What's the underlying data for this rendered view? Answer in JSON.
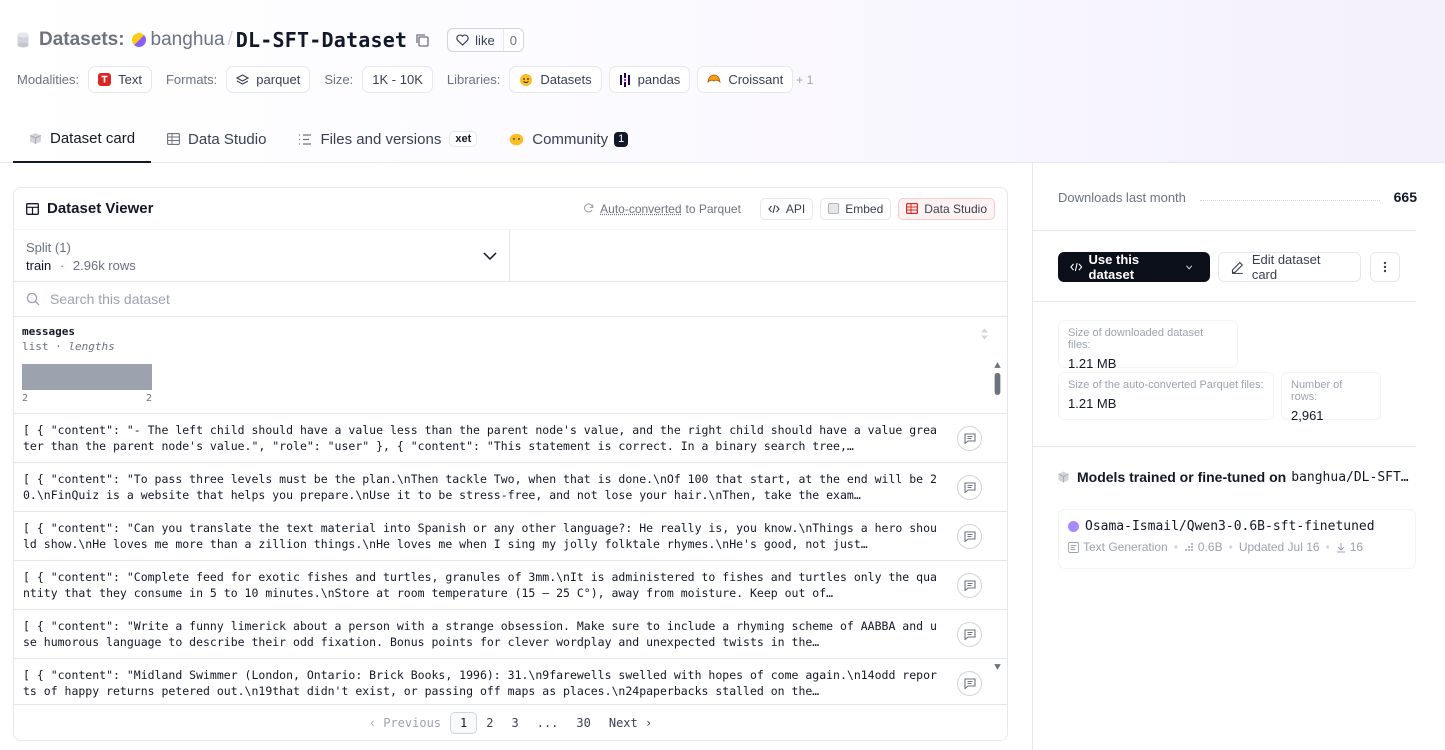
{
  "header": {
    "section": "Datasets:",
    "owner": "banghua",
    "slash": "/",
    "name": "DL-SFT-Dataset",
    "like_label": "like",
    "like_count": "0"
  },
  "meta": {
    "modalities_label": "Modalities:",
    "modality": "Text",
    "formats_label": "Formats:",
    "format": "parquet",
    "size_label": "Size:",
    "size": "1K - 10K",
    "libraries_label": "Libraries:",
    "libraries": [
      "Datasets",
      "pandas",
      "Croissant"
    ],
    "more_libraries": "+ 1"
  },
  "tabs": {
    "dataset_card": "Dataset card",
    "data_studio": "Data Studio",
    "files": "Files and versions",
    "xet": "xet",
    "community": "Community",
    "community_count": "1"
  },
  "viewer": {
    "title": "Dataset Viewer",
    "autoconverted": "Auto-converted",
    "autoconverted_suffix": "to Parquet",
    "api": "API",
    "embed": "Embed",
    "data_studio": "Data Studio",
    "split_label": "Split (1)",
    "split_name": "train",
    "split_sep": "·",
    "split_rows": "2.96k rows",
    "search_placeholder": "Search this dataset",
    "column": {
      "name": "messages",
      "type": "list",
      "type_sep": "·",
      "type_detail": "lengths",
      "hist_min": "2",
      "hist_max": "2"
    },
    "rows": [
      "[ { \"content\": \"- The left child should have a value less than the parent node's value, and the right child should have a value greater than the parent node's value.\", \"role\": \"user\" }, { \"content\": \"This statement is correct. In a binary search tree,…",
      "[ { \"content\": \"To pass three levels must be the plan.\\nThen tackle Two, when that is done.\\nOf 100 that start, at the end will be 20.\\nFinQuiz is a website that helps you prepare.\\nUse it to be stress-free, and not lose your hair.\\nThen, take the exam…",
      "[ { \"content\": \"Can you translate the text material into Spanish or any other language?: He really is, you know.\\nThings a hero should show.\\nHe loves me more than a zillion things.\\nHe loves me when I sing my jolly folktale rhymes.\\nHe's good, not just…",
      "[ { \"content\": \"Complete feed for exotic fishes and turtles, granules of 3mm.\\nIt is administered to fishes and turtles only the quantity that they consume in 5 to 10 minutes.\\nStore at room temperature (15 – 25 C°), away from moisture. Keep out of…",
      "[ { \"content\": \"Write a funny limerick about a person with a strange obsession. Make sure to include a rhyming scheme of AABBA and use humorous language to describe their odd fixation. Bonus points for clever wordplay and unexpected twists in the…",
      "[ { \"content\": \"Midland Swimmer (London, Ontario: Brick Books, 1996): 31.\\n9farewells swelled with hopes of come again.\\n14odd reports of happy returns petered out.\\n19that didn't exist, or passing off maps as places.\\n24paperbacks stalled on the…"
    ],
    "pagination": {
      "previous": "Previous",
      "pages": [
        "1",
        "2",
        "3",
        "...",
        "30"
      ],
      "next": "Next"
    }
  },
  "sidebar": {
    "downloads_label": "Downloads last month",
    "downloads_value": "665",
    "use_dataset": "Use this dataset",
    "edit_card": "Edit dataset card",
    "stats": {
      "dl_size_label": "Size of downloaded dataset files:",
      "dl_size_value": "1.21 MB",
      "parquet_size_label": "Size of the auto-converted Parquet files:",
      "parquet_size_value": "1.21 MB",
      "rows_label": "Number of rows:",
      "rows_value": "2,961"
    },
    "models_title": "Models trained or fine-tuned on",
    "models_dataset": "banghua/DL-SFT…",
    "model": {
      "name": "Osama-Ismail/Qwen3-0.6B-sft-finetuned",
      "task": "Text Generation",
      "size": "0.6B",
      "updated": "Updated Jul 16",
      "downloads": "16",
      "sep": "•"
    }
  }
}
